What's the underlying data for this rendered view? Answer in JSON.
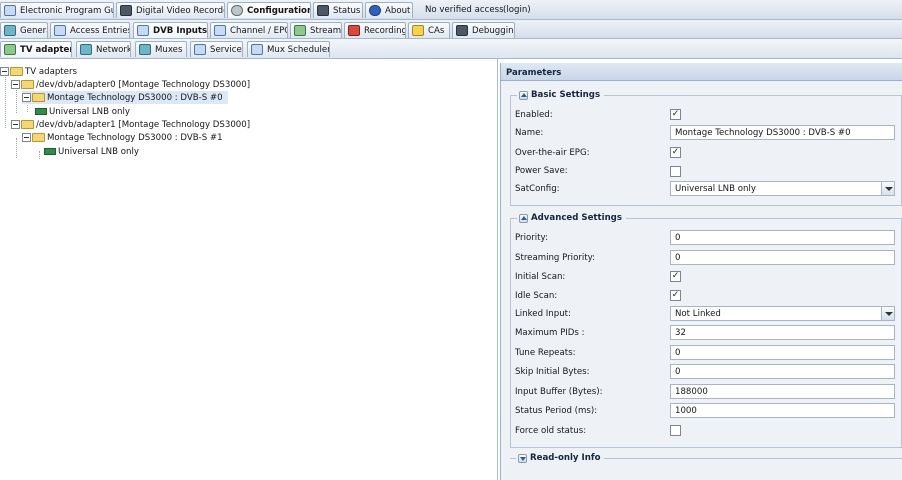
{
  "top_tabs": [
    {
      "label": "Electronic Program Guide",
      "icon": "tv-icon"
    },
    {
      "label": "Digital Video Recorder",
      "icon": "recorder-icon"
    },
    {
      "label": "Configuration",
      "icon": "wrench-icon"
    },
    {
      "label": "Status",
      "icon": "status-icon"
    },
    {
      "label": "About",
      "icon": "info-icon"
    }
  ],
  "access_status": "No verified access",
  "login_label": "(login)",
  "config_tabs": [
    {
      "label": "General",
      "icon": "general-icon"
    },
    {
      "label": "Access Entries",
      "icon": "access-icon"
    },
    {
      "label": "DVB Inputs",
      "icon": "dvb-icon"
    },
    {
      "label": "Channel / EPG",
      "icon": "channel-icon"
    },
    {
      "label": "Stream",
      "icon": "stream-icon"
    },
    {
      "label": "Recording",
      "icon": "recording-icon"
    },
    {
      "label": "CAs",
      "icon": "key-icon"
    },
    {
      "label": "Debugging",
      "icon": "bug-icon"
    }
  ],
  "dvb_tabs": [
    {
      "label": "TV adapters",
      "icon": "adapter-icon"
    },
    {
      "label": "Networks",
      "icon": "network-icon"
    },
    {
      "label": "Muxes",
      "icon": "mux-icon"
    },
    {
      "label": "Services",
      "icon": "services-icon"
    },
    {
      "label": "Mux Schedulers",
      "icon": "scheduler-icon"
    }
  ],
  "tree": {
    "root": "TV adapters",
    "adapter0": "/dev/dvb/adapter0 [Montage Technology DS3000]",
    "frontend0": "Montage Technology DS3000 : DVB-S #0",
    "lnb0": "Universal LNB only",
    "adapter1": "/dev/dvb/adapter1 [Montage Technology DS3000]",
    "frontend1": "Montage Technology DS3000 : DVB-S #1",
    "lnb1": "Universal LNB only"
  },
  "panel": {
    "title": "Parameters",
    "basic": {
      "legend": "Basic Settings",
      "enabled_label": "Enabled:",
      "enabled": true,
      "name_label": "Name:",
      "name": "Montage Technology DS3000 : DVB-S #0",
      "ota_epg_label": "Over-the-air EPG:",
      "ota_epg": true,
      "power_save_label": "Power Save:",
      "power_save": false,
      "satconfig_label": "SatConfig:",
      "satconfig": "Universal LNB only"
    },
    "advanced": {
      "legend": "Advanced Settings",
      "priority_label": "Priority:",
      "priority": "0",
      "streaming_priority_label": "Streaming Priority:",
      "streaming_priority": "0",
      "initial_scan_label": "Initial Scan:",
      "initial_scan": true,
      "idle_scan_label": "Idle Scan:",
      "idle_scan": true,
      "linked_input_label": "Linked Input:",
      "linked_input": "Not Linked",
      "max_pids_label": "Maximum PIDs :",
      "max_pids": "32",
      "tune_repeats_label": "Tune Repeats:",
      "tune_repeats": "0",
      "skip_initial_label": "Skip Initial Bytes:",
      "skip_initial": "0",
      "input_buffer_label": "Input Buffer (Bytes):",
      "input_buffer": "188000",
      "status_period_label": "Status Period (ms):",
      "status_period": "1000",
      "force_old_label": "Force old status:",
      "force_old": false
    },
    "readonly": {
      "legend": "Read-only Info"
    }
  }
}
